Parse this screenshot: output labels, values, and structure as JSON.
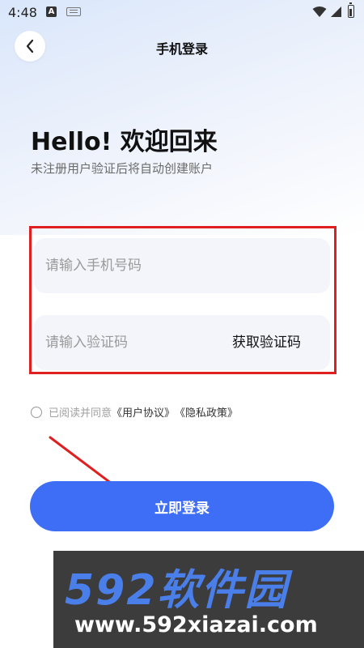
{
  "status_bar": {
    "time": "4:48",
    "notification_badge": "A"
  },
  "header": {
    "title": "手机登录"
  },
  "welcome": {
    "heading": "Hello! 欢迎回来",
    "subtitle": "未注册用户验证后将自动创建账户"
  },
  "form": {
    "phone_placeholder": "请输入手机号码",
    "phone_value": "",
    "code_placeholder": "请输入验证码",
    "code_value": "",
    "get_code_label": "获取验证码"
  },
  "agreement": {
    "prefix": "已阅读并同意",
    "user_agreement": "《用户协议》",
    "privacy_policy": "《隐私政策》",
    "checked": false
  },
  "login_button": {
    "label": "立即登录"
  },
  "watermark": {
    "brand": "592软件园",
    "url": "www.592xiazai.com"
  },
  "colors": {
    "primary": "#3f6ef6",
    "highlight": "#e02020",
    "input_bg": "#f3f5fa",
    "watermark_bg": "#3c3c3c",
    "watermark_brand": "#4a7ee8"
  },
  "icons": {
    "back": "chevron-left-icon",
    "wifi": "wifi-icon",
    "signal": "signal-icon",
    "battery": "battery-icon",
    "keyboard": "keyboard-icon"
  }
}
